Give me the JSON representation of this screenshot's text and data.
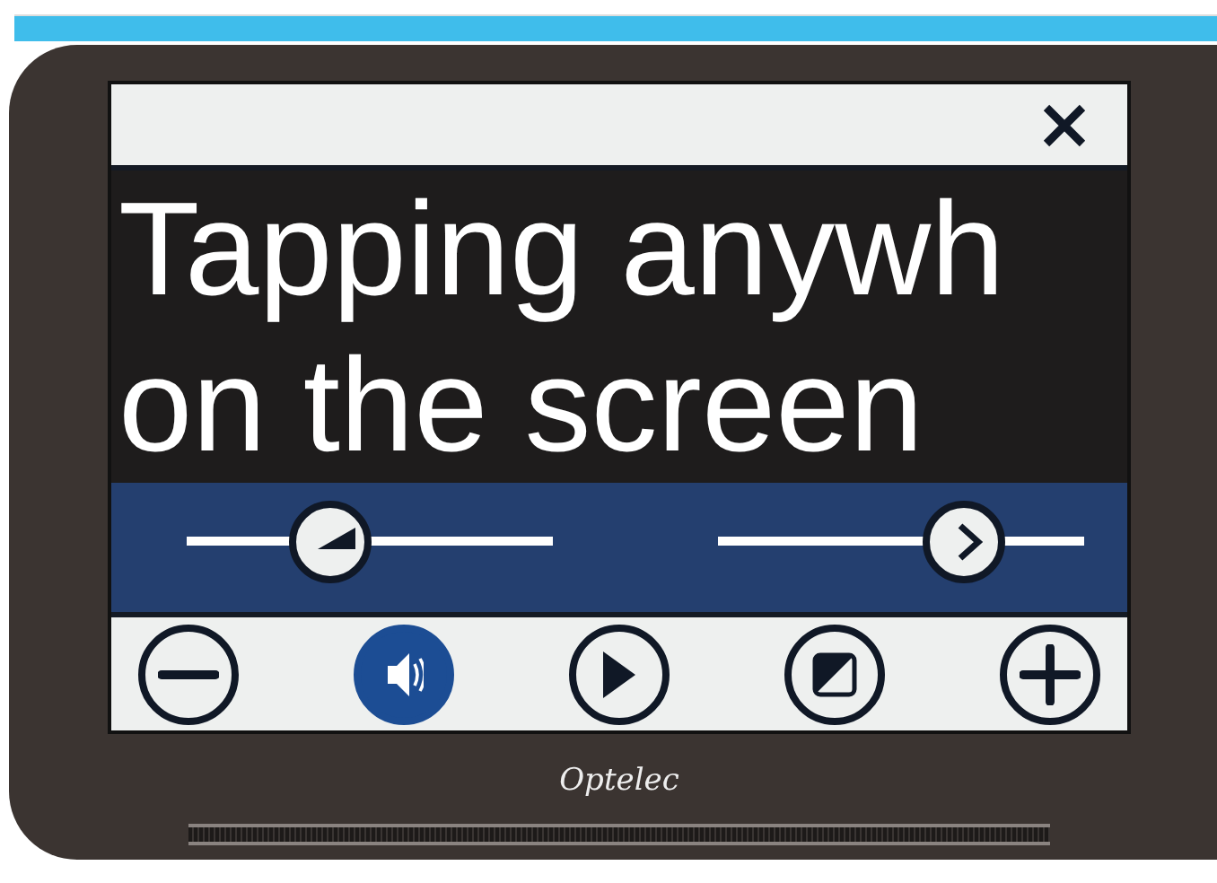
{
  "document": {
    "lines": [
      "Tapping anywh",
      "on the screen"
    ]
  },
  "sliders": [
    {
      "kind": "volume",
      "level": 0.39
    },
    {
      "kind": "speed",
      "level": 0.67
    }
  ],
  "toolbar": [
    {
      "kind": "zoom-out",
      "selected": false
    },
    {
      "kind": "speech",
      "selected": true
    },
    {
      "kind": "play",
      "selected": false
    },
    {
      "kind": "contrast",
      "selected": false
    },
    {
      "kind": "zoom-in",
      "selected": false
    }
  ],
  "brand": "Optelec"
}
